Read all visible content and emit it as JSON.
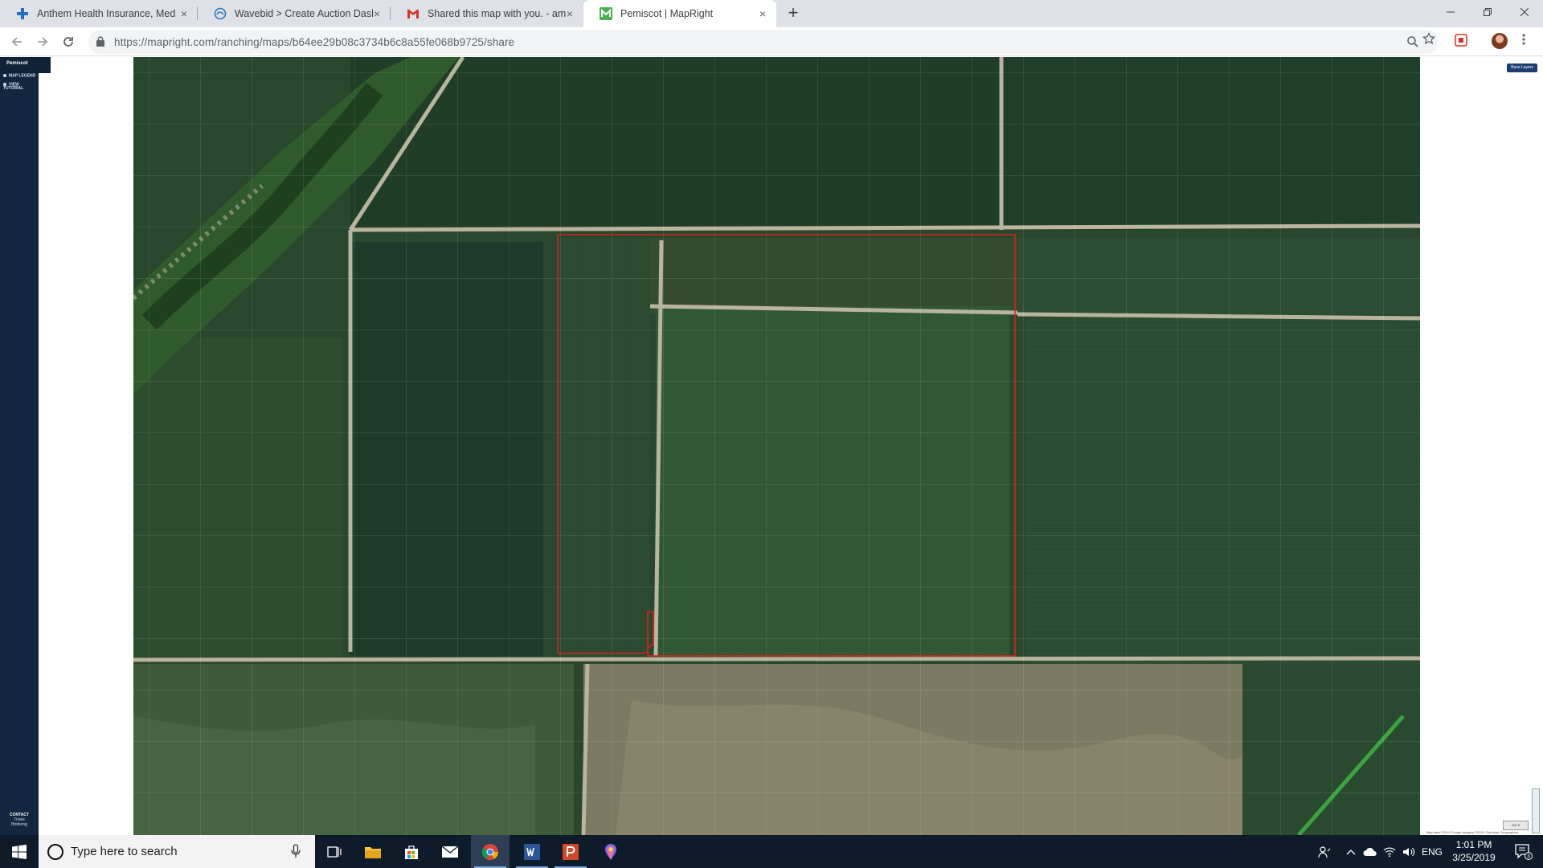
{
  "browser": {
    "tabs": [
      {
        "title": "Anthem Health Insurance, Medic",
        "icon": "anthem-cross-icon",
        "active": false
      },
      {
        "title": "Wavebid > Create Auction Dashb",
        "icon": "wavebid-icon",
        "active": false
      },
      {
        "title": "Shared this map with you. - amy",
        "icon": "gmail-icon",
        "active": false
      },
      {
        "title": "Pemiscot | MapRight",
        "icon": "mapright-icon",
        "active": true
      }
    ],
    "url": "https://mapright.com/ranching/maps/b64ee29b08c3734b6c8a55fe068b9725/share",
    "accent_color": "#1a73e8"
  },
  "app": {
    "sidebar_title": "Pemiscot",
    "links": [
      "MAP LEGEND",
      "VIEW TUTORIAL"
    ],
    "contact_label": "CONTACT",
    "contact_name_1": "Travis",
    "contact_name_2": "Birdsong",
    "layers_label": "Base Layers",
    "map_credit": "Map data ©2019 Google Imagery ©2019, Earthstar Geographics",
    "scale_label": "200 ft",
    "boundary_color": "#e0201c"
  },
  "taskbar": {
    "search_placeholder": "Type here to search",
    "language": "ENG",
    "time": "1:01 PM",
    "date": "3/25/2019",
    "notification_count": "3"
  }
}
